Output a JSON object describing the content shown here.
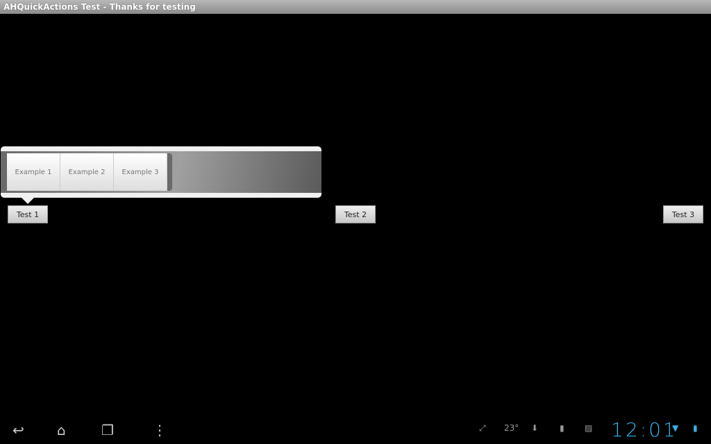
{
  "title": "AHQuickActions Test - Thanks for testing",
  "popup": {
    "items": [
      "Example 1",
      "Example 2",
      "Example 3"
    ]
  },
  "buttons": [
    "Test 1",
    "Test 2",
    "Test 3"
  ],
  "status": {
    "temperature": "23°",
    "clock": "12:01",
    "accent": "#33b5e5"
  }
}
